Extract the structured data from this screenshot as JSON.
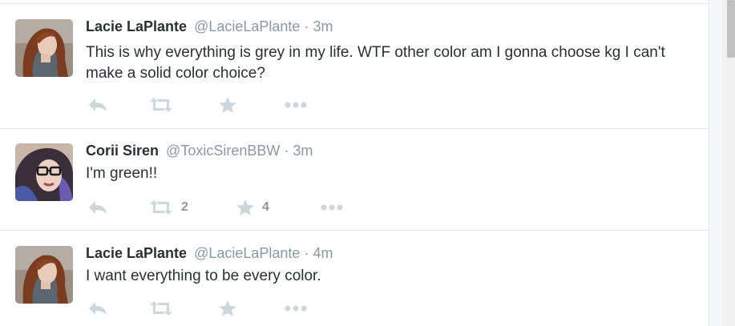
{
  "tweets": [
    {
      "fullname": "Lacie LaPlante",
      "username": "@LacieLaPlante",
      "separator": "·",
      "time": "3m",
      "text": "This is why everything is grey in my life. WTF other color am I gonna choose kg I can't make a solid color choice?",
      "avatar": "lacie-avatar",
      "retweet_count": "",
      "favorite_count": ""
    },
    {
      "fullname": "Corii Siren",
      "username": "@ToxicSirenBBW",
      "separator": "·",
      "time": "3m",
      "text": "I'm green!!",
      "avatar": "corii-avatar",
      "retweet_count": "2",
      "favorite_count": "4"
    },
    {
      "fullname": "Lacie LaPlante",
      "username": "@LacieLaPlante",
      "separator": "·",
      "time": "4m",
      "text": "I want everything to be every color.",
      "avatar": "lacie-avatar",
      "retweet_count": "",
      "favorite_count": ""
    }
  ],
  "icons": {
    "reply": "reply-icon",
    "retweet": "retweet-icon",
    "favorite": "star-icon",
    "more": "more-dots-icon"
  },
  "colors": {
    "name": "#292f33",
    "meta": "#8899a6",
    "icon": "#ccd6dd",
    "divider": "#e1e8ed"
  }
}
